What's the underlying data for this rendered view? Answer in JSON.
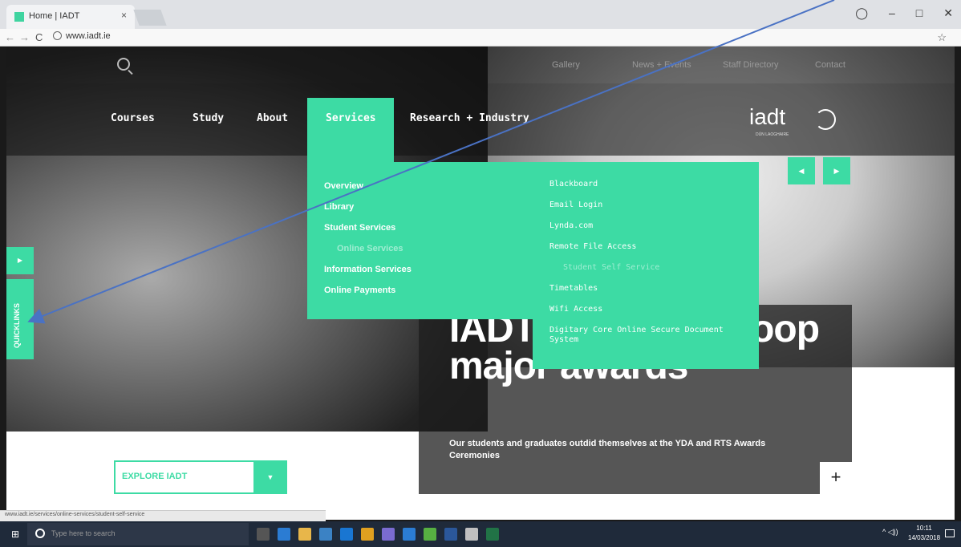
{
  "browser": {
    "tab_title": "Home | IADT",
    "tab_close": "×",
    "url": "www.iadt.ie",
    "status_url": "www.iadt.ie/services/online-services/student-self-service",
    "back": "←",
    "forward": "→",
    "reload": "C",
    "star": "☆",
    "win_min": "–",
    "win_max": "□",
    "win_close": "✕",
    "profile": "◯"
  },
  "topnav": {
    "items": [
      "Gallery",
      "News + Events",
      "Staff Directory",
      "Contact"
    ]
  },
  "mainnav": {
    "items": [
      "Courses",
      "Study",
      "About",
      "Services",
      "Research + Industry"
    ],
    "logo": "iadt",
    "logo_sub": "DÚN LAOGHAIRE"
  },
  "dropdown": {
    "left": [
      "Overview",
      "Library",
      "Student Services",
      "Online Services",
      "Information Services",
      "Online Payments"
    ],
    "right": [
      "Blackboard",
      "Email Login",
      "Lynda.com",
      "Remote File Access",
      "Student Self Service",
      "Timetables",
      "Wifi Access",
      "Digitary Core Online Secure Document System"
    ]
  },
  "slider": {
    "prev": "◀",
    "next": "▶"
  },
  "quicklinks": {
    "label": "QUICKLINKS",
    "arrow": "▶"
  },
  "hero": {
    "headline": "IADT students scoop major awards",
    "subline": "Our students and graduates outdid themselves at the YDA and RTS Awards Ceremonies",
    "plus": "+"
  },
  "explore": {
    "label": "EXPLORE IADT",
    "arrow": "▼"
  },
  "taskbar": {
    "search_placeholder": "Type here to search",
    "time": "10:11",
    "date": "14/03/2018",
    "tray": "^ ◁))"
  },
  "colors": {
    "accent": "#3ddba4",
    "annotation": "#4a72c4"
  }
}
